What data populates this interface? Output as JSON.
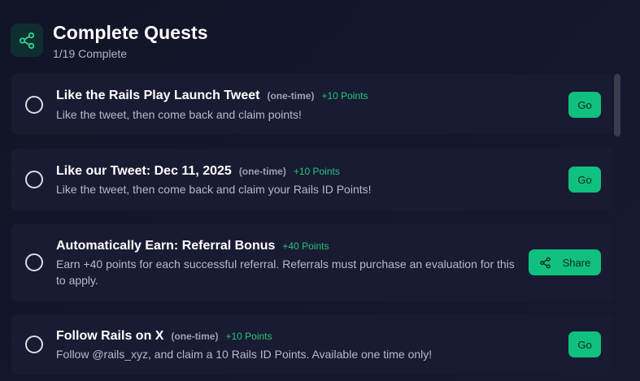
{
  "header": {
    "title": "Complete Quests",
    "progress": "1/19 Complete",
    "icon": "share-icon"
  },
  "colors": {
    "accent": "#10c07f",
    "points_text": "#22c77d",
    "card_bg": "#191b32",
    "page_bg": "#121427"
  },
  "quests": [
    {
      "title": "Like the Rails Play Launch Tweet",
      "tag": "(one-time)",
      "points": "+10 Points",
      "description": "Like the tweet, then come back and claim points!",
      "button_label": "Go",
      "button_icon": null,
      "completed": false
    },
    {
      "title": "Like our Tweet: Dec 11, 2025",
      "tag": "(one-time)",
      "points": "+10 Points",
      "description": "Like the tweet, then come back and claim your Rails ID Points!",
      "button_label": "Go",
      "button_icon": null,
      "completed": false
    },
    {
      "title": "Automatically Earn: Referral Bonus",
      "tag": "",
      "points": "+40 Points",
      "description": "Earn +40 points for each successful referral. Referrals must purchase an evaluation for this to apply.",
      "button_label": "Share",
      "button_icon": "share-icon",
      "completed": false
    },
    {
      "title": "Follow Rails on X",
      "tag": "(one-time)",
      "points": "+10 Points",
      "description": "Follow @rails_xyz, and claim a 10 Rails ID Points. Available one time only!",
      "button_label": "Go",
      "button_icon": null,
      "completed": false
    }
  ]
}
